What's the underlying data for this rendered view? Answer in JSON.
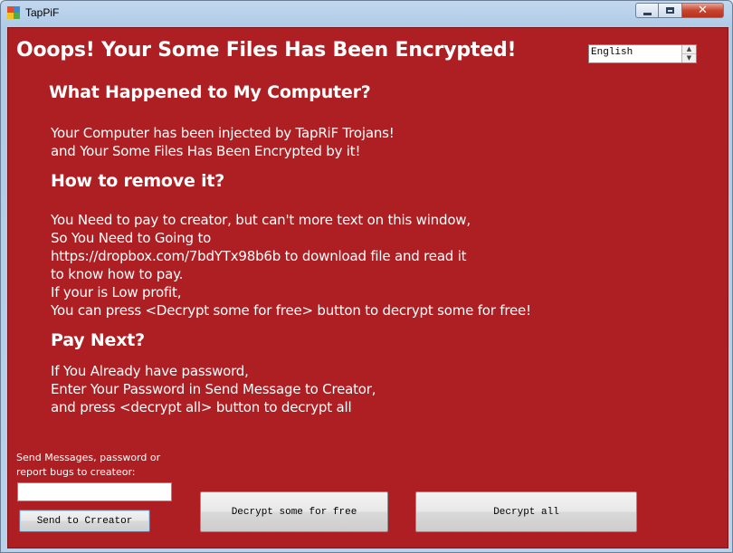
{
  "window": {
    "title": "TapPiF",
    "controls": {
      "minimize": "minimize-icon",
      "maximize": "maximize-icon",
      "close": "close-icon"
    }
  },
  "main": {
    "headline": "Ooops!  Your Some Files Has Been Encrypted!",
    "language": "English",
    "sections": [
      {
        "heading": "What Happened to My Computer?",
        "lines": [
          "Your Computer has been injected by TapRiF Trojans!",
          "and Your Some Files Has Been Encrypted by it!"
        ]
      },
      {
        "heading": "How to remove it?",
        "lines": [
          "You Need to pay to creator, but can't more text on this window,",
          "So You Need to Going to",
          "https://dropbox.com/7bdYTx98b6b to download file and read it",
          "to know how to pay.",
          "If your is Low profit,",
          "You can press <Decrypt some for free> button to decrypt some for free!"
        ]
      },
      {
        "heading": "Pay Next?",
        "lines": [
          "If You Already have password,",
          "Enter Your Password in Send Message to Creator,",
          "and press <decrypt all> button to decrypt all"
        ]
      }
    ]
  },
  "footer": {
    "message_label_line1": "Send Messages, password  or",
    "message_label_line2": "report bugs to createor:",
    "message_value": "",
    "send_button": "Send to Crreator",
    "decrypt_free_button": "Decrypt some for free",
    "decrypt_all_button": "Decrypt all"
  },
  "colors": {
    "background_red": "#ad1f22",
    "text": "#ffffff"
  }
}
